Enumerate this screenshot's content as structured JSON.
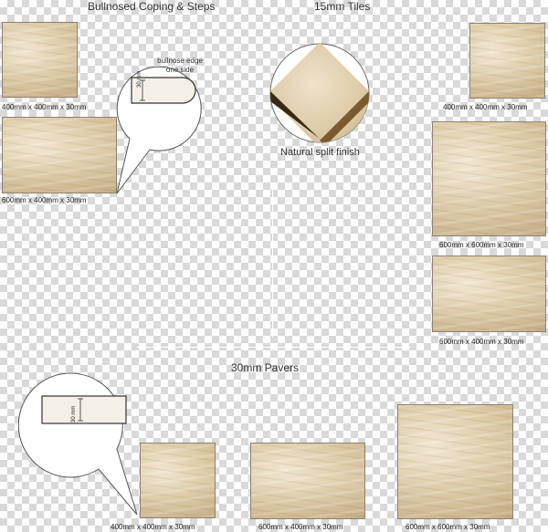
{
  "headings": {
    "coping": "Bullnosed Coping & Steps",
    "tiles": "15mm Tiles",
    "pavers": "30mm Pavers"
  },
  "coping": {
    "bubble_text_line1": "bullnose edge",
    "bubble_text_line2": "one side",
    "thickness_label": "30 mm",
    "items": [
      {
        "label": "400mm x 400mm x 30mm"
      },
      {
        "label": "600mm x 400mm x 30mm"
      }
    ]
  },
  "tiles": {
    "finish_label": "Natural split finish",
    "items": [
      {
        "label": "400mm x 400mm x 30mm"
      },
      {
        "label": "600mm x 600mm x 30mm"
      },
      {
        "label": "600mm x 400mm x 30mm"
      }
    ]
  },
  "pavers": {
    "thickness_label": "30 mm",
    "items": [
      {
        "label": "400mm x 400mm x 30mm"
      },
      {
        "label": "600mm x 400mm x 30mm"
      },
      {
        "label": "600mm x 600mm x 30mm"
      }
    ]
  }
}
